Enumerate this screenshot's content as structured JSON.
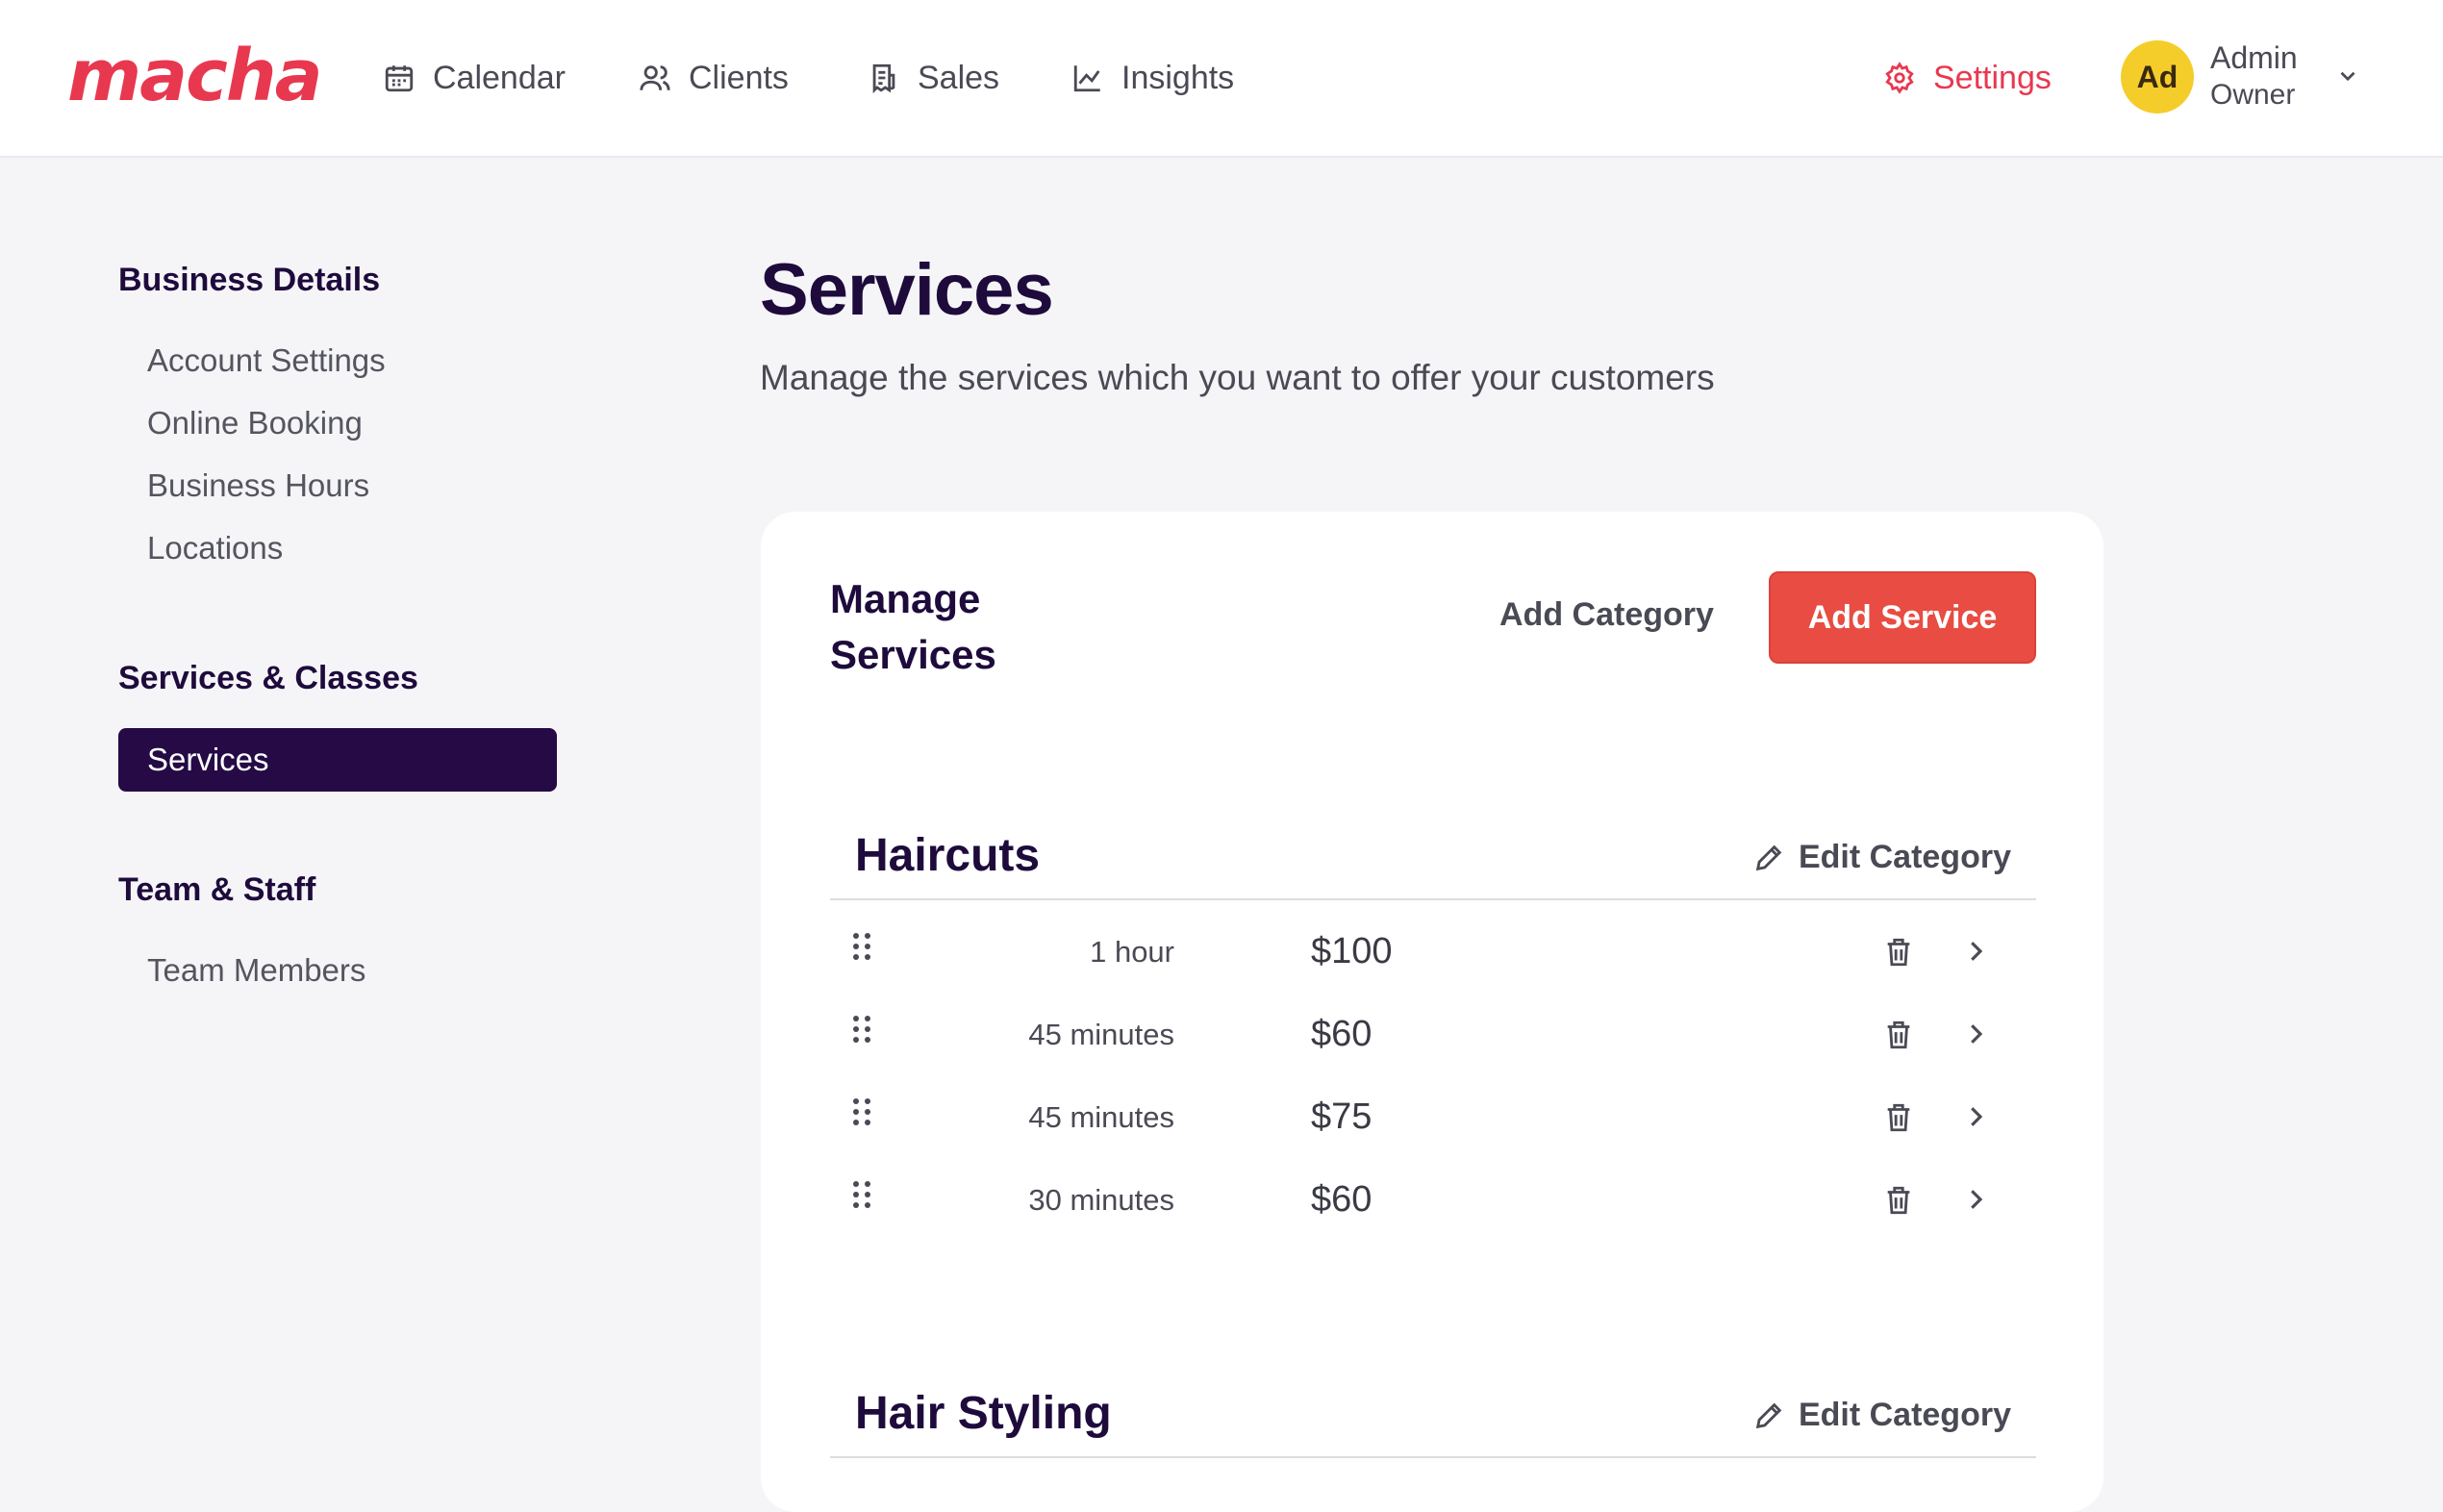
{
  "brand": {
    "logo": "macha",
    "accent": "#e8384f",
    "dark": "#250a45"
  },
  "nav": {
    "calendar": "Calendar",
    "clients": "Clients",
    "sales": "Sales",
    "insights": "Insights",
    "settings": "Settings"
  },
  "user": {
    "initials": "Ad",
    "name": "Admin",
    "role": "Owner"
  },
  "sidebar": {
    "business_heading": "Business Details",
    "business_items": [
      "Account Settings",
      "Online Booking",
      "Business Hours",
      "Locations"
    ],
    "services_heading": "Services & Classes",
    "services_active": "Services",
    "team_heading": "Team & Staff",
    "team_items": [
      "Team Members"
    ]
  },
  "main": {
    "title": "Services",
    "subtitle": "Manage the services which you want to offer your customers",
    "card_title": "Manage Services",
    "add_category": "Add Category",
    "add_service": "Add Service",
    "edit_category": "Edit Category",
    "categories": [
      {
        "name": "Haircuts",
        "services": [
          {
            "duration": "1 hour",
            "price": "$100"
          },
          {
            "duration": "45 minutes",
            "price": "$60"
          },
          {
            "duration": "45 minutes",
            "price": "$75"
          },
          {
            "duration": "30 minutes",
            "price": "$60"
          }
        ]
      },
      {
        "name": "Hair Styling",
        "services": []
      }
    ]
  }
}
